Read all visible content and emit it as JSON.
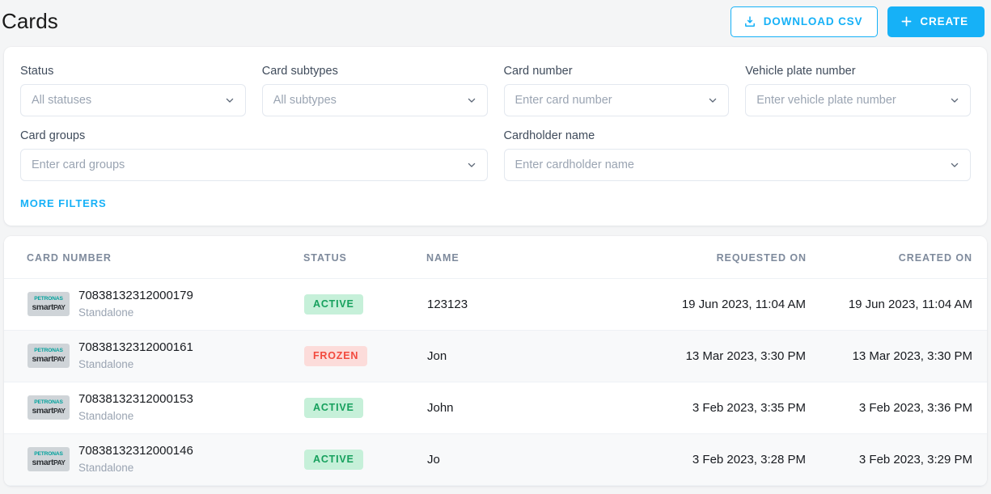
{
  "header": {
    "title": "Cards",
    "download_label": "DOWNLOAD CSV",
    "create_label": "CREATE",
    "download_icon": "download-tray-icon",
    "create_icon": "plus-icon",
    "accent_color": "#16b1f7"
  },
  "filters": {
    "more_filters_label": "MORE FILTERS",
    "fields": [
      {
        "label": "Status",
        "placeholder": "All statuses",
        "value": ""
      },
      {
        "label": "Card subtypes",
        "placeholder": "All subtypes",
        "value": ""
      },
      {
        "label": "Card number",
        "placeholder": "Enter card number",
        "value": ""
      },
      {
        "label": "Vehicle plate number",
        "placeholder": "Enter vehicle plate number",
        "value": ""
      },
      {
        "label": "Card groups",
        "placeholder": "Enter card groups",
        "value": ""
      },
      {
        "label": "Cardholder name",
        "placeholder": "Enter cardholder name",
        "value": ""
      }
    ]
  },
  "table": {
    "columns": [
      "CARD NUMBER",
      "STATUS",
      "NAME",
      "REQUESTED ON",
      "CREATED ON"
    ],
    "brand": {
      "top": "PETRONAS",
      "bottom_main": "smart",
      "bottom_accent": "PAY"
    },
    "rows": [
      {
        "card_number": "70838132312000179",
        "card_subtype": "Standalone",
        "status": "ACTIVE",
        "status_kind": "active",
        "name": "123123",
        "requested_on": "19 Jun 2023, 11:04 AM",
        "created_on": "19 Jun 2023, 11:04 AM"
      },
      {
        "card_number": "70838132312000161",
        "card_subtype": "Standalone",
        "status": "FROZEN",
        "status_kind": "frozen",
        "name": "Jon",
        "requested_on": "13 Mar 2023, 3:30 PM",
        "created_on": "13 Mar 2023, 3:30 PM"
      },
      {
        "card_number": "70838132312000153",
        "card_subtype": "Standalone",
        "status": "ACTIVE",
        "status_kind": "active",
        "name": "John",
        "requested_on": "3 Feb 2023, 3:35 PM",
        "created_on": "3 Feb 2023, 3:36 PM"
      },
      {
        "card_number": "70838132312000146",
        "card_subtype": "Standalone",
        "status": "ACTIVE",
        "status_kind": "active",
        "name": "Jo",
        "requested_on": "3 Feb 2023, 3:28 PM",
        "created_on": "3 Feb 2023, 3:29 PM"
      }
    ]
  }
}
